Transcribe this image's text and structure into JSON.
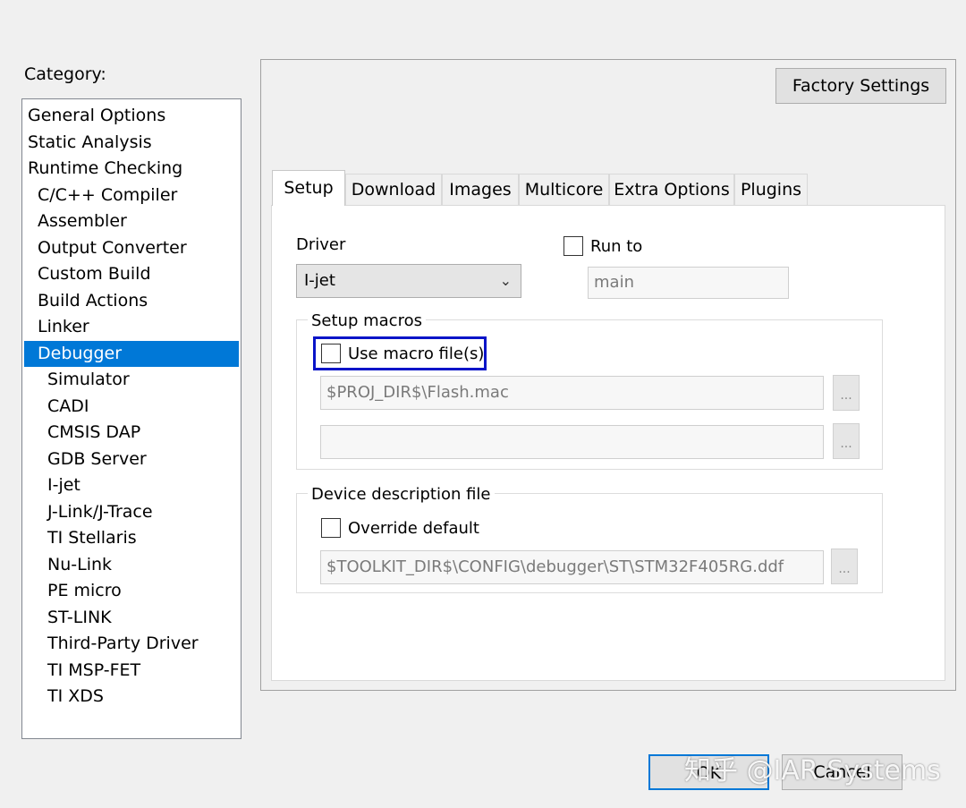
{
  "category": {
    "label": "Category:",
    "items": [
      {
        "label": "General Options",
        "level": 0
      },
      {
        "label": "Static Analysis",
        "level": 0
      },
      {
        "label": "Runtime Checking",
        "level": 0
      },
      {
        "label": "C/C++ Compiler",
        "level": 1
      },
      {
        "label": "Assembler",
        "level": 1
      },
      {
        "label": "Output Converter",
        "level": 1
      },
      {
        "label": "Custom Build",
        "level": 1
      },
      {
        "label": "Build Actions",
        "level": 1
      },
      {
        "label": "Linker",
        "level": 1
      },
      {
        "label": "Debugger",
        "level": 1,
        "selected": true
      },
      {
        "label": "Simulator",
        "level": 2
      },
      {
        "label": "CADI",
        "level": 2
      },
      {
        "label": "CMSIS DAP",
        "level": 2
      },
      {
        "label": "GDB Server",
        "level": 2
      },
      {
        "label": "I-jet",
        "level": 2
      },
      {
        "label": "J-Link/J-Trace",
        "level": 2
      },
      {
        "label": "TI Stellaris",
        "level": 2
      },
      {
        "label": "Nu-Link",
        "level": 2
      },
      {
        "label": "PE micro",
        "level": 2
      },
      {
        "label": "ST-LINK",
        "level": 2
      },
      {
        "label": "Third-Party Driver",
        "level": 2
      },
      {
        "label": "TI MSP-FET",
        "level": 2
      },
      {
        "label": "TI XDS",
        "level": 2
      }
    ]
  },
  "factory_settings_label": "Factory Settings",
  "tabs": [
    "Setup",
    "Download",
    "Images",
    "Multicore",
    "Extra Options",
    "Plugins"
  ],
  "active_tab": "Setup",
  "setup": {
    "driver_label": "Driver",
    "driver_value": "I-jet",
    "run_to_label": "Run to",
    "run_to_checked": false,
    "run_to_value": "main",
    "setup_macros_title": "Setup macros",
    "use_macro_label": "Use macro file(s)",
    "use_macro_checked": false,
    "macro_file_1": "$PROJ_DIR$\\Flash.mac",
    "macro_file_2": "",
    "browse_label": "...",
    "device_desc_title": "Device description file",
    "override_label": "Override default",
    "override_checked": false,
    "ddf_path": "$TOOLKIT_DIR$\\CONFIG\\debugger\\ST\\STM32F405RG.ddf"
  },
  "footer": {
    "ok_label": "OK",
    "cancel_label": "Cancel"
  },
  "watermark": "知乎 @IAR Systems",
  "colors": {
    "selection": "#0078d7",
    "highlight_box": "#0a14c8"
  }
}
